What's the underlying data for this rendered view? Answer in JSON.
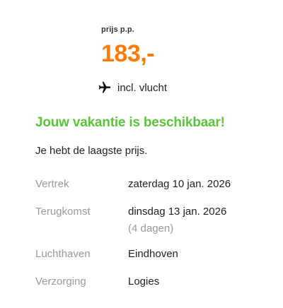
{
  "colors": {
    "price": "#ff7a00",
    "available": "#5cc43c",
    "muted": "#9a9a9a",
    "text": "#222222"
  },
  "price": {
    "label": "prijs p.p.",
    "value": "183,-"
  },
  "flight": {
    "icon": "airplane-icon",
    "text": "incl. vlucht"
  },
  "availability": {
    "headline": "Jouw vakantie is beschikbaar!",
    "subline": "Je hebt de laagste prijs."
  },
  "details": [
    {
      "key": "Vertrek",
      "value": "zaterdag 10 jan. 2026"
    },
    {
      "key": "Terugkomst",
      "value": "dinsdag 13 jan. 2026",
      "note": "(4 dagen)"
    },
    {
      "key": "Luchthaven",
      "value": "Eindhoven"
    },
    {
      "key": "Verzorging",
      "value": "Logies"
    }
  ]
}
